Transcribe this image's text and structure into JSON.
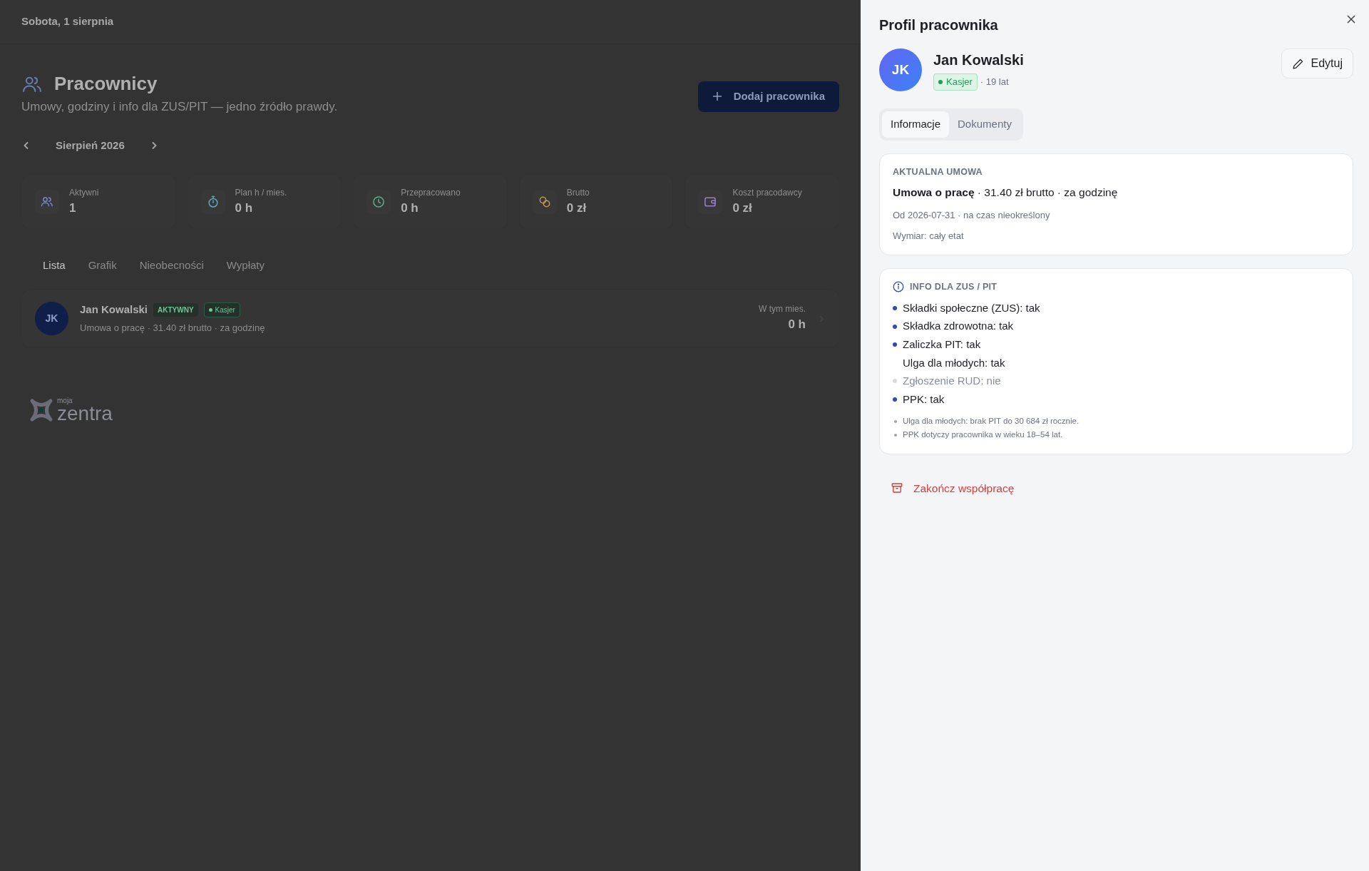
{
  "header": {
    "date": "Sobota, 1 sierpnia"
  },
  "page": {
    "title": "Pracownicy",
    "subtitle": "Umowy, godziny i info dla ZUS/PIT — jedno źródło prawdy.",
    "add_button": "Dodaj pracownika"
  },
  "month_nav": {
    "label": "Sierpień 2026"
  },
  "stats": [
    {
      "kind": "people",
      "label": "Aktywni",
      "value": "1"
    },
    {
      "kind": "stopwatch",
      "label": "Plan h / mies.",
      "value": "0 h"
    },
    {
      "kind": "clock",
      "label": "Przepracowano",
      "value": "0 h"
    },
    {
      "kind": "coins",
      "label": "Brutto",
      "value": "0 zł"
    },
    {
      "kind": "wallet",
      "label": "Koszt pracodawcy",
      "value": "0 zł"
    }
  ],
  "tabs": [
    {
      "label": "Lista",
      "selected": true
    },
    {
      "label": "Grafik",
      "selected": false
    },
    {
      "label": "Nieobecności",
      "selected": false
    },
    {
      "label": "Wypłaty",
      "selected": false
    }
  ],
  "employees": [
    {
      "initials": "JK",
      "name": "Jan Kowalski",
      "status": "AKTYWNY",
      "role": "Kasjer",
      "contract": "Umowa o pracę · 31.40 zł brutto · za godzinę",
      "hours_label": "W tym mies.",
      "hours": "0 h"
    }
  ],
  "logo": {
    "small": "moja",
    "big": "zentra"
  },
  "drawer": {
    "title": "Profil pracownika",
    "initials": "JK",
    "name": "Jan Kowalski",
    "role": "Kasjer",
    "age": "· 19 lat",
    "edit_button": "Edytuj",
    "tabs": [
      {
        "label": "Informacje",
        "selected": true
      },
      {
        "label": "Dokumenty",
        "selected": false
      }
    ],
    "contract": {
      "heading": "AKTUALNA UMOWA",
      "summary": "**Umowa o pracę** · 31.40 zł brutto · za godzinę",
      "dates": "Od 2026-07-31 · na czas nieokreślony",
      "scope": "Wymiar: cały etat"
    },
    "tax_info": {
      "heading": "INFO DLA ZUS / PIT",
      "items": [
        {
          "kind": "yes",
          "text": "Składki społeczne (ZUS): tak"
        },
        {
          "kind": "yes",
          "text": "Składka zdrowotna: tak"
        },
        {
          "kind": "yes",
          "text": "Zaliczka PIT: tak"
        },
        {
          "kind": "plain",
          "text": "Ulga dla młodych: tak"
        },
        {
          "kind": "no",
          "text": "Zgłoszenie RUD: nie"
        },
        {
          "kind": "yes",
          "text": "PPK: tak"
        }
      ],
      "notes": [
        "Ulga dla młodych: brak PIT do 30 684 zł rocznie.",
        "PPK dotyczy pracownika w wieku 18–54 lat."
      ]
    },
    "end_button": "Zakończ współpracę"
  }
}
